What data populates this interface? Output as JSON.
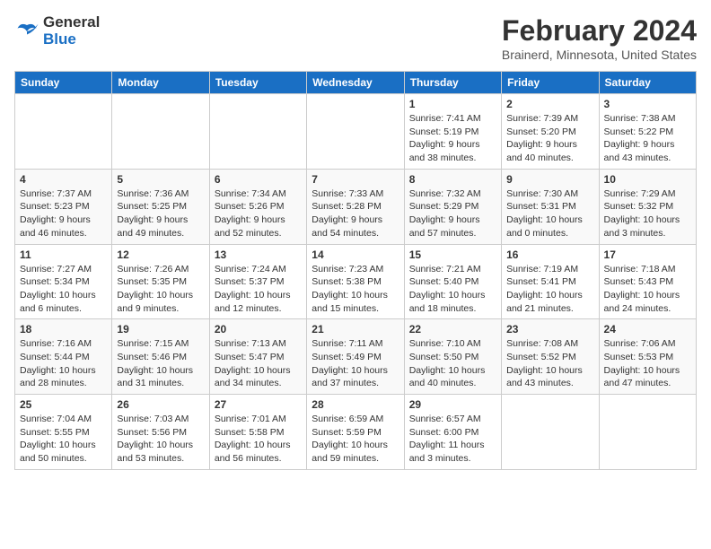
{
  "header": {
    "logo_line1": "General",
    "logo_line2": "Blue",
    "main_title": "February 2024",
    "subtitle": "Brainerd, Minnesota, United States"
  },
  "calendar": {
    "days_of_week": [
      "Sunday",
      "Monday",
      "Tuesday",
      "Wednesday",
      "Thursday",
      "Friday",
      "Saturday"
    ],
    "weeks": [
      [
        {
          "day": "",
          "info": ""
        },
        {
          "day": "",
          "info": ""
        },
        {
          "day": "",
          "info": ""
        },
        {
          "day": "",
          "info": ""
        },
        {
          "day": "1",
          "info": "Sunrise: 7:41 AM\nSunset: 5:19 PM\nDaylight: 9 hours\nand 38 minutes."
        },
        {
          "day": "2",
          "info": "Sunrise: 7:39 AM\nSunset: 5:20 PM\nDaylight: 9 hours\nand 40 minutes."
        },
        {
          "day": "3",
          "info": "Sunrise: 7:38 AM\nSunset: 5:22 PM\nDaylight: 9 hours\nand 43 minutes."
        }
      ],
      [
        {
          "day": "4",
          "info": "Sunrise: 7:37 AM\nSunset: 5:23 PM\nDaylight: 9 hours\nand 46 minutes."
        },
        {
          "day": "5",
          "info": "Sunrise: 7:36 AM\nSunset: 5:25 PM\nDaylight: 9 hours\nand 49 minutes."
        },
        {
          "day": "6",
          "info": "Sunrise: 7:34 AM\nSunset: 5:26 PM\nDaylight: 9 hours\nand 52 minutes."
        },
        {
          "day": "7",
          "info": "Sunrise: 7:33 AM\nSunset: 5:28 PM\nDaylight: 9 hours\nand 54 minutes."
        },
        {
          "day": "8",
          "info": "Sunrise: 7:32 AM\nSunset: 5:29 PM\nDaylight: 9 hours\nand 57 minutes."
        },
        {
          "day": "9",
          "info": "Sunrise: 7:30 AM\nSunset: 5:31 PM\nDaylight: 10 hours\nand 0 minutes."
        },
        {
          "day": "10",
          "info": "Sunrise: 7:29 AM\nSunset: 5:32 PM\nDaylight: 10 hours\nand 3 minutes."
        }
      ],
      [
        {
          "day": "11",
          "info": "Sunrise: 7:27 AM\nSunset: 5:34 PM\nDaylight: 10 hours\nand 6 minutes."
        },
        {
          "day": "12",
          "info": "Sunrise: 7:26 AM\nSunset: 5:35 PM\nDaylight: 10 hours\nand 9 minutes."
        },
        {
          "day": "13",
          "info": "Sunrise: 7:24 AM\nSunset: 5:37 PM\nDaylight: 10 hours\nand 12 minutes."
        },
        {
          "day": "14",
          "info": "Sunrise: 7:23 AM\nSunset: 5:38 PM\nDaylight: 10 hours\nand 15 minutes."
        },
        {
          "day": "15",
          "info": "Sunrise: 7:21 AM\nSunset: 5:40 PM\nDaylight: 10 hours\nand 18 minutes."
        },
        {
          "day": "16",
          "info": "Sunrise: 7:19 AM\nSunset: 5:41 PM\nDaylight: 10 hours\nand 21 minutes."
        },
        {
          "day": "17",
          "info": "Sunrise: 7:18 AM\nSunset: 5:43 PM\nDaylight: 10 hours\nand 24 minutes."
        }
      ],
      [
        {
          "day": "18",
          "info": "Sunrise: 7:16 AM\nSunset: 5:44 PM\nDaylight: 10 hours\nand 28 minutes."
        },
        {
          "day": "19",
          "info": "Sunrise: 7:15 AM\nSunset: 5:46 PM\nDaylight: 10 hours\nand 31 minutes."
        },
        {
          "day": "20",
          "info": "Sunrise: 7:13 AM\nSunset: 5:47 PM\nDaylight: 10 hours\nand 34 minutes."
        },
        {
          "day": "21",
          "info": "Sunrise: 7:11 AM\nSunset: 5:49 PM\nDaylight: 10 hours\nand 37 minutes."
        },
        {
          "day": "22",
          "info": "Sunrise: 7:10 AM\nSunset: 5:50 PM\nDaylight: 10 hours\nand 40 minutes."
        },
        {
          "day": "23",
          "info": "Sunrise: 7:08 AM\nSunset: 5:52 PM\nDaylight: 10 hours\nand 43 minutes."
        },
        {
          "day": "24",
          "info": "Sunrise: 7:06 AM\nSunset: 5:53 PM\nDaylight: 10 hours\nand 47 minutes."
        }
      ],
      [
        {
          "day": "25",
          "info": "Sunrise: 7:04 AM\nSunset: 5:55 PM\nDaylight: 10 hours\nand 50 minutes."
        },
        {
          "day": "26",
          "info": "Sunrise: 7:03 AM\nSunset: 5:56 PM\nDaylight: 10 hours\nand 53 minutes."
        },
        {
          "day": "27",
          "info": "Sunrise: 7:01 AM\nSunset: 5:58 PM\nDaylight: 10 hours\nand 56 minutes."
        },
        {
          "day": "28",
          "info": "Sunrise: 6:59 AM\nSunset: 5:59 PM\nDaylight: 10 hours\nand 59 minutes."
        },
        {
          "day": "29",
          "info": "Sunrise: 6:57 AM\nSunset: 6:00 PM\nDaylight: 11 hours\nand 3 minutes."
        },
        {
          "day": "",
          "info": ""
        },
        {
          "day": "",
          "info": ""
        }
      ]
    ]
  }
}
